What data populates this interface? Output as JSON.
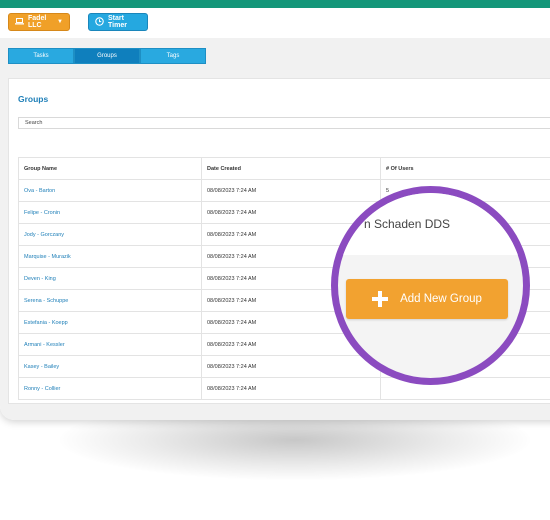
{
  "header": {
    "company_label": "Fadel LLC",
    "timer_label": "Start Timer"
  },
  "tabs": [
    {
      "label": "Tasks",
      "active": false
    },
    {
      "label": "Groups",
      "active": true
    },
    {
      "label": "Tags",
      "active": false
    }
  ],
  "page": {
    "title": "Groups",
    "search_value": "Search"
  },
  "table": {
    "columns": [
      "Group Name",
      "Date Created",
      "# Of Users"
    ],
    "rows": [
      {
        "name": "Ova - Barton",
        "date": "08/08/2023 7:24 AM",
        "users": "5"
      },
      {
        "name": "Felipe - Cronin",
        "date": "08/08/2023 7:24 AM",
        "users": ""
      },
      {
        "name": "Jody - Gorczany",
        "date": "08/08/2023 7:24 AM",
        "users": ""
      },
      {
        "name": "Marquise - Murazik",
        "date": "08/08/2023 7:24 AM",
        "users": ""
      },
      {
        "name": "Deven - King",
        "date": "08/08/2023 7:24 AM",
        "users": ""
      },
      {
        "name": "Serena - Schuppe",
        "date": "08/08/2023 7:24 AM",
        "users": ""
      },
      {
        "name": "Estefania - Koepp",
        "date": "08/08/2023 7:24 AM",
        "users": ""
      },
      {
        "name": "Armani - Kessler",
        "date": "08/08/2023 7:24 AM",
        "users": ""
      },
      {
        "name": "Kasey - Bailey",
        "date": "08/08/2023 7:24 AM",
        "users": ""
      },
      {
        "name": "Ronny - Collier",
        "date": "08/08/2023 7:24 AM",
        "users": ""
      }
    ]
  },
  "magnifier": {
    "partial_name": "n Schaden DDS",
    "add_button_label": "Add New Group"
  },
  "colors": {
    "accent_teal": "#14977a",
    "tab_blue": "#29a9e0",
    "tab_active": "#0f7fbd",
    "orange": "#f2a230",
    "magnifier_ring": "#8b4bc0",
    "link_blue": "#1e7fb8"
  },
  "icons": {
    "company": "laptop-icon",
    "timer": "clock-icon",
    "add": "plus-icon"
  }
}
